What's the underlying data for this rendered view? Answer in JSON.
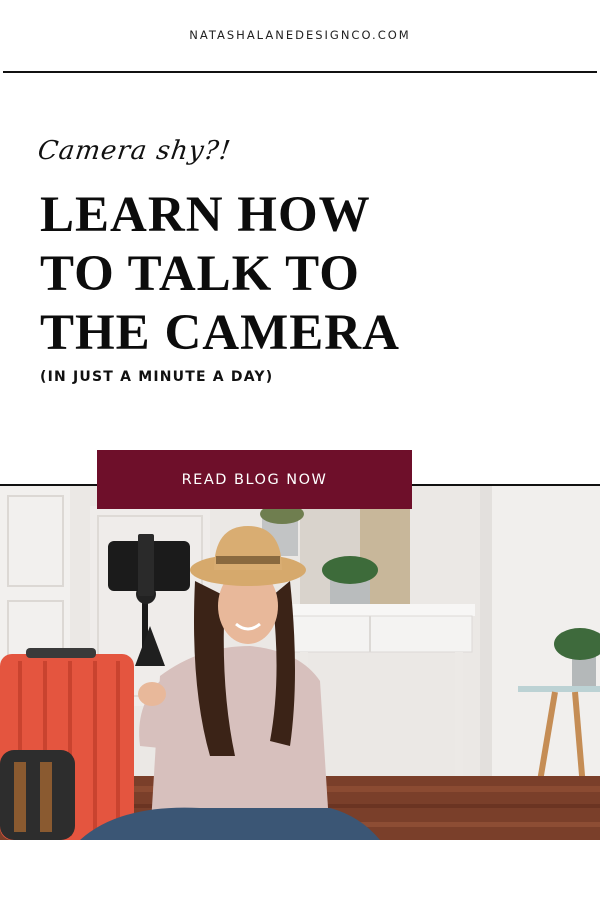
{
  "site": {
    "url": "NATASHALANEDESIGNCO.COM"
  },
  "hero": {
    "script_text": "Camera shy?!",
    "headline_lines": [
      "LEARN HOW",
      "TO TALK TO",
      "THE CAMERA"
    ],
    "subheadline": "(IN JUST A MINUTE A DAY)"
  },
  "cta": {
    "label": "READ BLOG NOW"
  },
  "colors": {
    "accent": "#6e0f2a",
    "text": "#0c0c0c"
  },
  "photo": {
    "subject": "woman-vlogging-with-phone-tripod"
  }
}
